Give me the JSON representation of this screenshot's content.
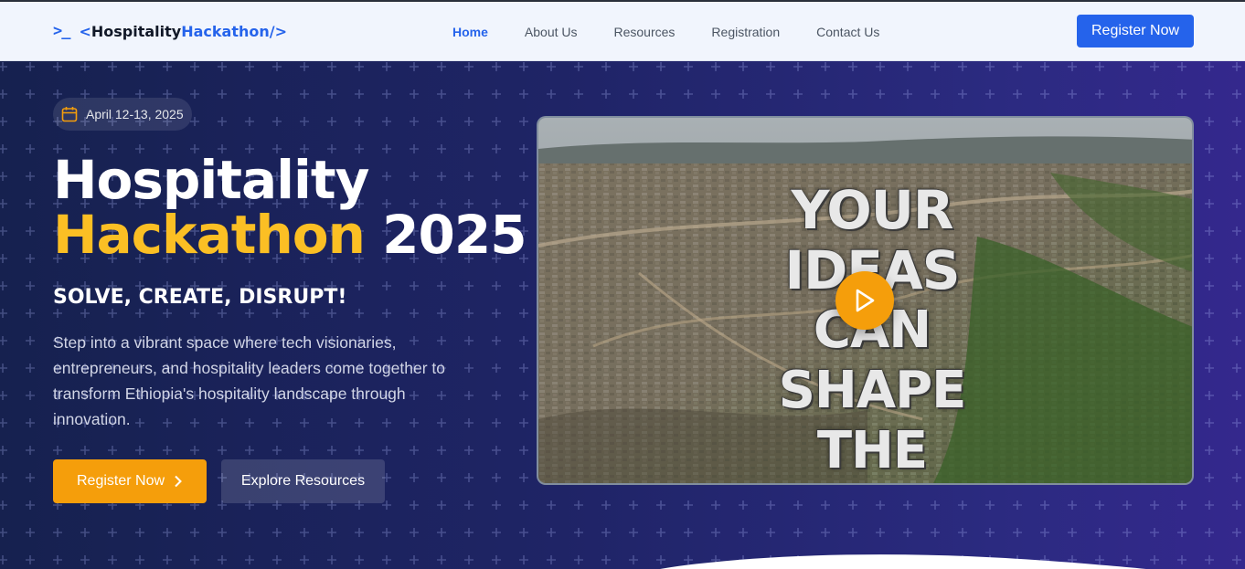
{
  "nav": {
    "logo": {
      "prefix": "<",
      "part1": "Hospitality",
      "part2": "Hackathon",
      "suffix": "/>",
      "icon": "terminal-icon"
    },
    "links": [
      "Home",
      "About Us",
      "Resources",
      "Registration",
      "Contact Us"
    ],
    "active_link": "Home",
    "cta": "Register Now"
  },
  "hero": {
    "date": "April 12-13, 2025",
    "date_icon": "calendar-icon",
    "title_line1": "Hospitality",
    "title_highlight": "Hackathon",
    "title_year": "2025",
    "tagline": "SOLVE, CREATE, DISRUPT!",
    "description": "Step into a vibrant space where tech visionaries, entrepreneurs, and hospitality leaders come together to transform Ethiopia's hospitality landscape through innovation.",
    "primary_button": "Register Now",
    "secondary_button": "Explore Resources"
  },
  "video": {
    "overlay_lines": [
      "YOUR",
      "IDEAS",
      "CAN SHAPE",
      "THE FUTURE"
    ],
    "play_icon": "play-icon"
  },
  "colors": {
    "accent_blue": "#2563eb",
    "accent_amber": "#f59e0b",
    "highlight_yellow": "#fbbf24"
  }
}
